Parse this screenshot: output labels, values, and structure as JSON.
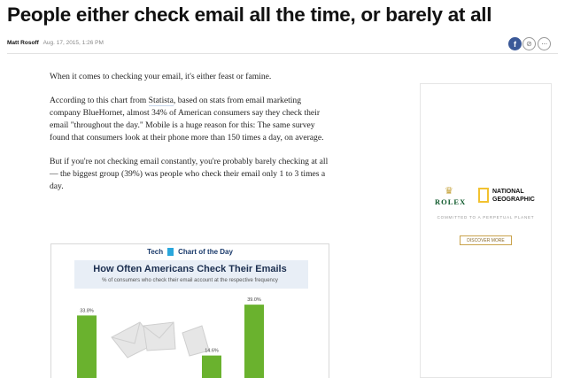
{
  "headline": "People either check email all the time, or barely at all",
  "byline": {
    "author": "Matt Rosoff",
    "date": "Aug. 17, 2015, 1:26 PM"
  },
  "share": {
    "facebook": "f",
    "link": "⊘",
    "more": "···"
  },
  "article": {
    "p1": "When it comes to checking your email, it's either feast or famine.",
    "p2_before": "According to this chart from ",
    "p2_link": "Statista",
    "p2_after": ", based on stats from email marketing company BlueHornet, almost 34% of American consumers say they check their email \"throughout the day.\" Mobile is a huge reason for this: The same survey found that consumers look at their phone more than 150 times a day, on average.",
    "p3": "But if you're not checking email constantly, you're probably barely checking at all — the biggest group (39%) was people who check their email only 1 to 3 times a day."
  },
  "chart_header": {
    "brand": "Tech",
    "label": "Chart of the Day"
  },
  "chart_data": {
    "type": "bar",
    "title": "How Often Americans Check Their Emails",
    "subtitle": "% of consumers who check their email account at the respective frequency",
    "categories": [
      "",
      "",
      ""
    ],
    "values": [
      33.8,
      14.6,
      39.0
    ],
    "value_labels": [
      "33.8%",
      "14.6%",
      "39.0%"
    ],
    "ylim": [
      0,
      45
    ],
    "bar_color": "#6ab22e"
  },
  "ad": {
    "brand1": "ROLEX",
    "brand2_line1": "NATIONAL",
    "brand2_line2": "GEOGRAPHIC",
    "tagline": "COMMITTED TO A PERPETUAL PLANET",
    "cta": "DISCOVER MORE"
  },
  "colors": {
    "facebook": "#3b5998",
    "rolex_green": "#0f5a2c",
    "natgeo_yellow": "#f2c230"
  }
}
